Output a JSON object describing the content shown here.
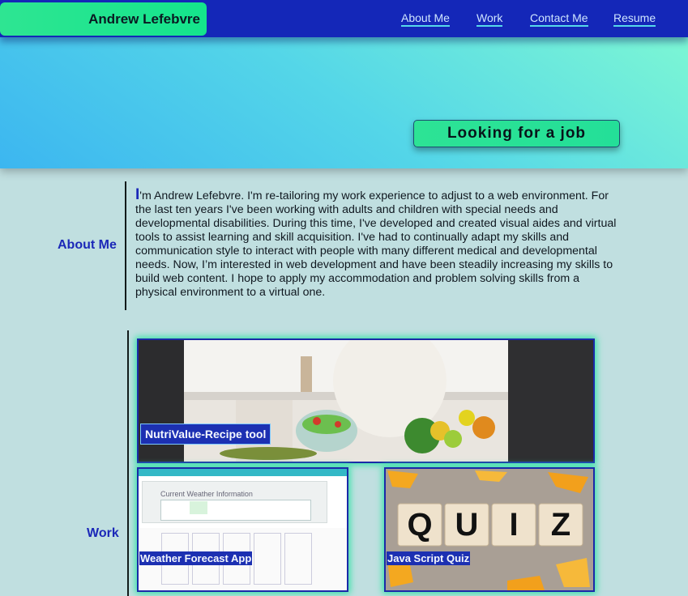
{
  "header": {
    "brand": "Andrew Lefebvre",
    "nav": [
      {
        "label": "About Me"
      },
      {
        "label": "Work"
      },
      {
        "label": "Contact Me"
      },
      {
        "label": "Resume"
      }
    ]
  },
  "hero": {
    "badge": "Looking for a job"
  },
  "about": {
    "heading": "About Me",
    "first_letter": "I",
    "body": "'m Andrew Lefebvre. I'm re-tailoring my work experience to adjust to a web environment. For the last ten years I've been working with adults and children with special needs and developmental disabilities. During this time, I've developed and created visual aides and virtual tools to assist learning and skill acquisition. I've had to continually adapt my skills and communication style to interact with people with many different medical and developmental needs. Now, I’m interested in web development and have been steadily increasing my skills to build web content. I hope to apply my accommodation and problem solving skills from a physical environment to a virtual one."
  },
  "work": {
    "heading": "Work",
    "projects": [
      {
        "title": "NutriValue-Recipe tool"
      },
      {
        "title": "Weather Forecast App",
        "screenshot_heading": "Current Weather Information"
      },
      {
        "title": "Java Script Quiz",
        "tiles": [
          "Q",
          "U",
          "I",
          "Z"
        ]
      }
    ]
  },
  "colors": {
    "navbar": "#1427b8",
    "accent_green": "#2ee592",
    "heading_blue": "#1b28b8",
    "page_background": "#c0dfe0"
  }
}
